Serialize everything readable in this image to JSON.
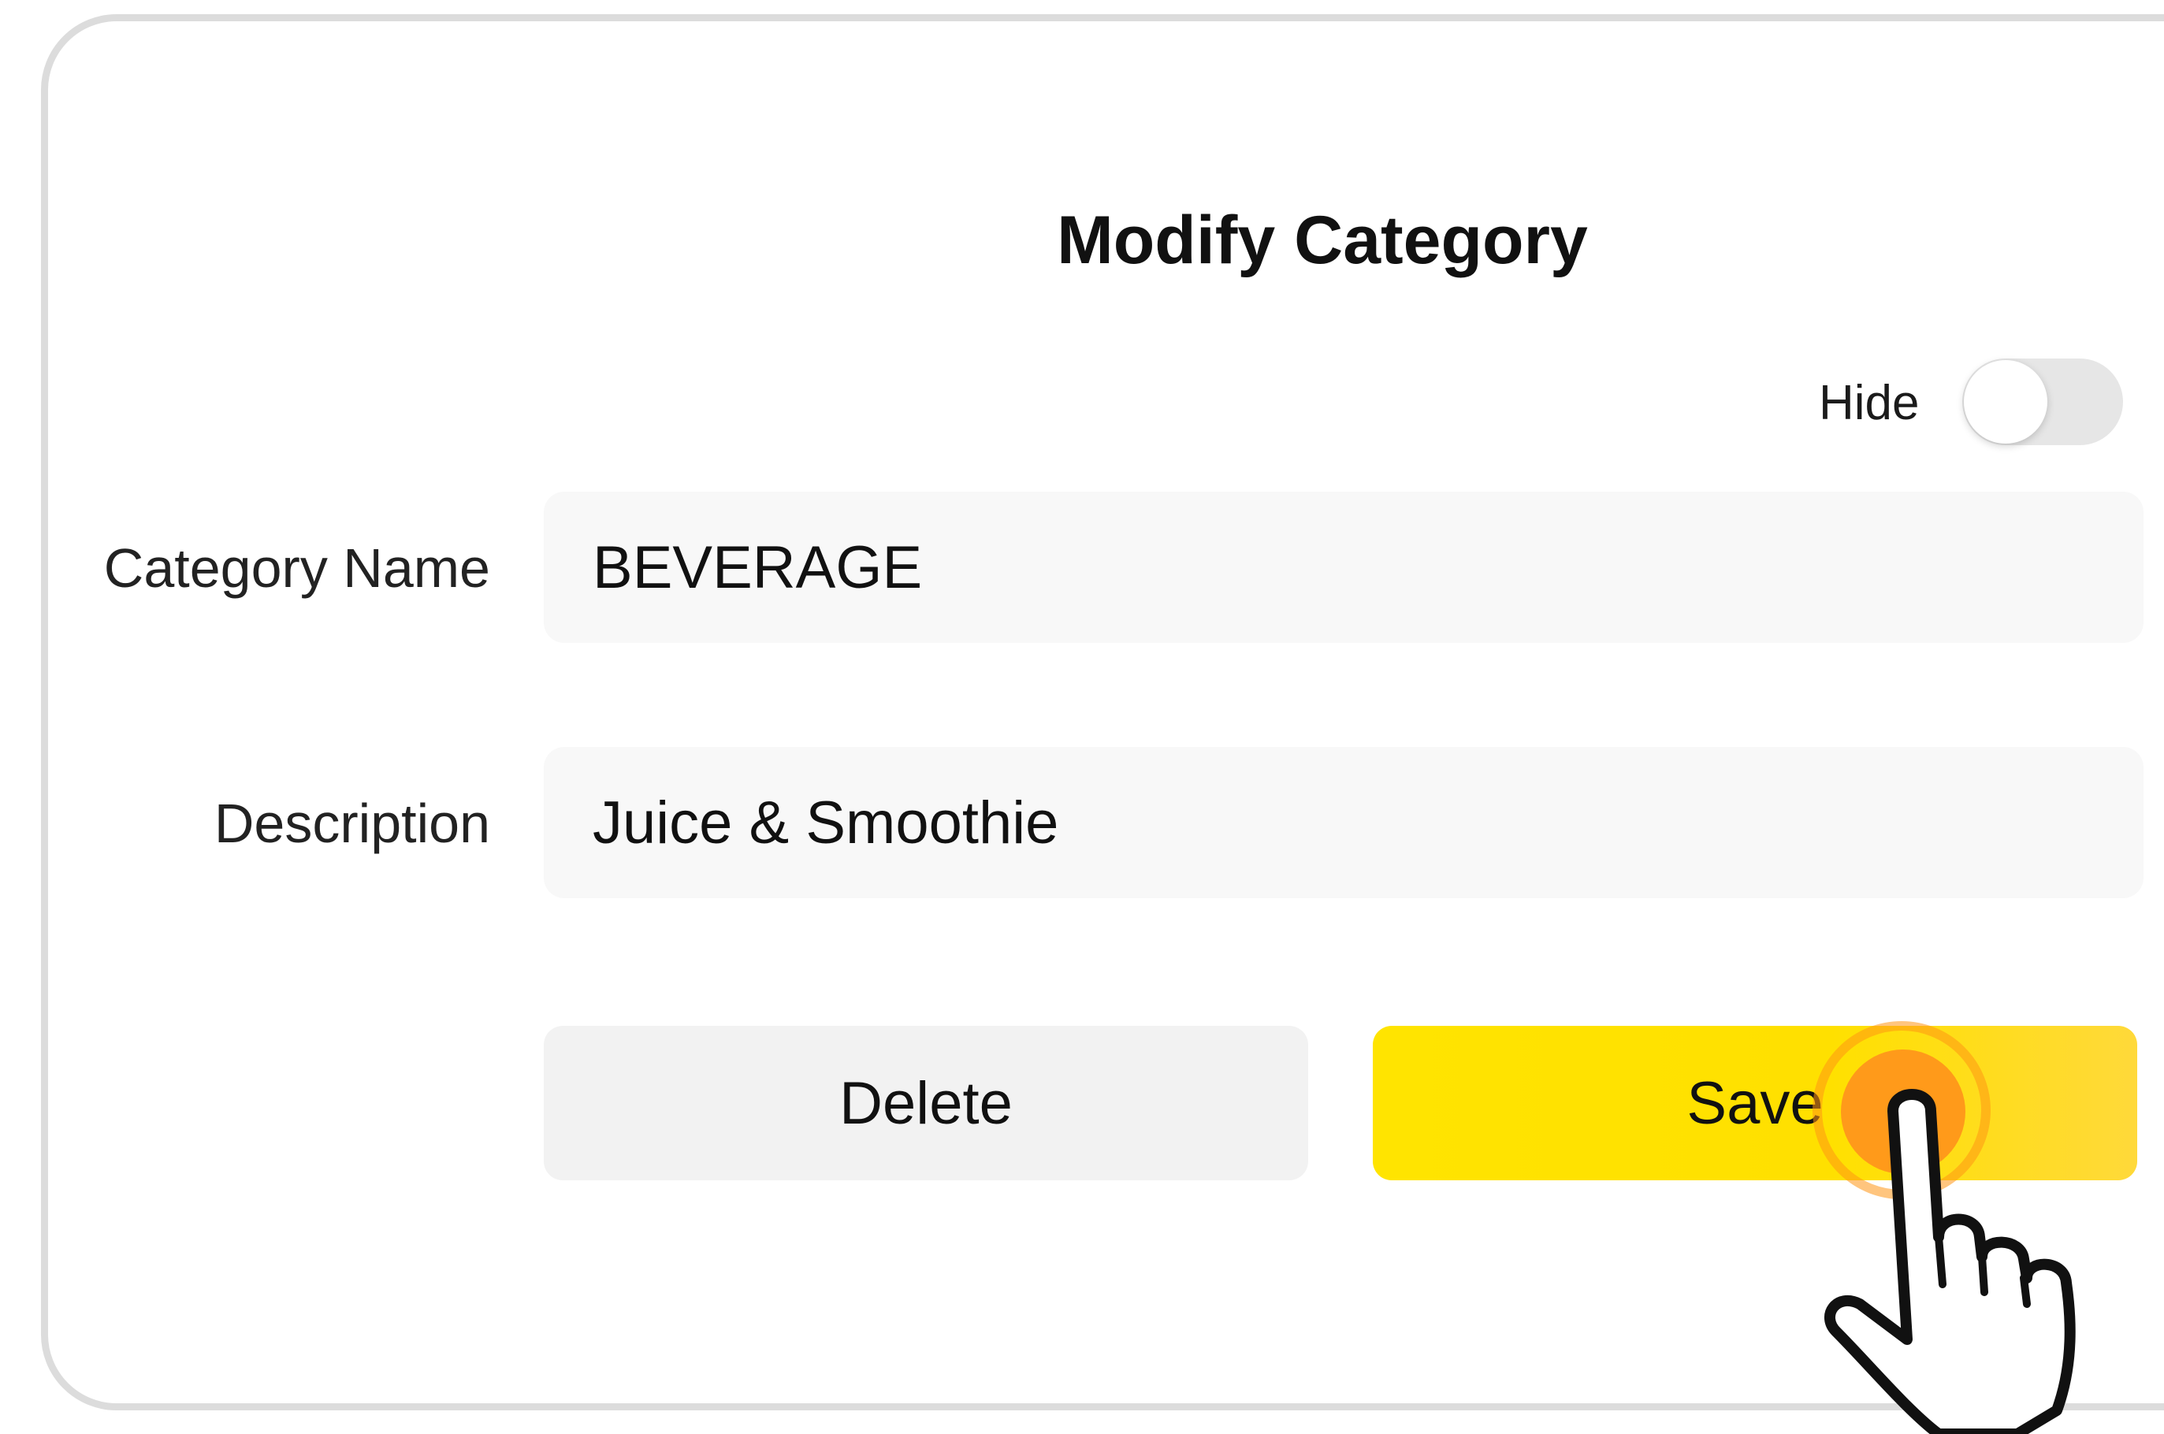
{
  "dialog": {
    "title": "Modify Category",
    "hide_toggle": {
      "label": "Hide",
      "checked": false
    },
    "fields": {
      "category_name": {
        "label": "Category Name",
        "value": "BEVERAGE"
      },
      "description": {
        "label": "Description",
        "value": "Juice & Smoothie"
      }
    },
    "buttons": {
      "delete_label": "Delete",
      "save_label": "Save"
    }
  },
  "colors": {
    "save_button": "#FFE400",
    "delete_button": "#F2F2F2",
    "tap_indicator": "#FF9A1A",
    "field_background": "#F8F8F8",
    "dialog_border": "#DCDCDC"
  },
  "icons": {
    "tap_pointer": "pointing-hand-icon"
  }
}
